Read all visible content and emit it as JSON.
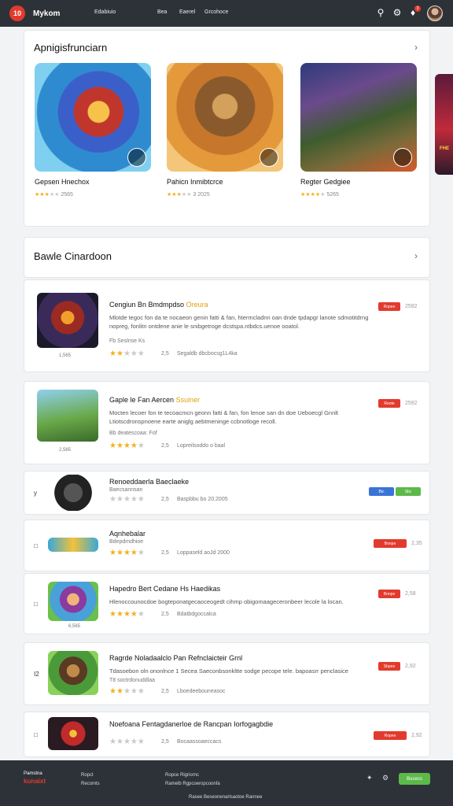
{
  "header": {
    "logo_text": "10",
    "brand": "Mykom",
    "nav": [
      "Edabiuio",
      "Bea",
      "Eaerel",
      "Grcohoce"
    ],
    "notification_count": "3"
  },
  "featured": {
    "title": "Apnigisfrunciarn",
    "games": [
      {
        "title": "Gepsen Hnechox",
        "rating_text": "2565"
      },
      {
        "title": "Pahicn Inmibtcrce",
        "rating_text": "3 2025"
      },
      {
        "title": "Regter Gedgiee",
        "rating_text": "5265"
      }
    ],
    "edge_tile_text": "FHE"
  },
  "section": {
    "title": "Bawle Cinardoon"
  },
  "list": [
    {
      "name": "Cengiun Bn Bmdmpdso",
      "tag": "Oreura",
      "desc": "Mlotde tegoc fon da te nocaeon genin fatti & fan, htermcladnn oan dnde tpdapgr lanote sdmotitdrng nopreg, fonlitn ontdene anie le snibgetroge dcstspa.ntbdcs.uenoe ooatol.",
      "meta": "Fb Seslnse  Ks",
      "rating": "2,5",
      "stats": "Segaldb dbcbocsg1L4ka",
      "caption": "1,565",
      "button": "Ropee",
      "num": "2592"
    },
    {
      "name": "Gaple le Fan Aercen",
      "tag": "Ssuiner",
      "desc": "Mocten lecoer fon te tecoacmcn geonn fatti & fan, fon lenoe san dn doe Ueboecgl Gnnlt Ltiotscdronspnoene earte aniglg aebtmeninge ccbnotloge recoll.",
      "meta": "Bb deatescoaa: Fof",
      "rating": "2,5",
      "stats": "Lopreilsoddo o baal",
      "caption": "2,565",
      "button": "Reote",
      "num": "2592"
    },
    {
      "name": "Renoeddaerla Baeclaeke",
      "tag": "Baecsannsan",
      "desc": "",
      "meta": "",
      "rating": "2,5",
      "stats": "Baspbbu  bo 20.2005",
      "caption": "",
      "button": "",
      "num": "",
      "left": "y"
    },
    {
      "name": "Aqnhebalar",
      "tag": "Bdepdmdhioe",
      "desc": "",
      "meta": "",
      "rating": "2,5",
      "stats": "Loppaseld  aoJd 2000",
      "caption": "",
      "button": "Bonpe",
      "num": "2,35",
      "left": "□"
    },
    {
      "name": "Hapedro Bert Cedane Hs Haedikas",
      "tag": "",
      "desc": "Hlenoccounocdoe bogteponatgecaoceogedt cihmp obigomaageceronbeer lecole la locan.",
      "meta": "",
      "rating": "2,5",
      "stats": "Bdatbdgoccalca",
      "caption": "6,565",
      "button": "Bonpe",
      "num": "2,58",
      "left": "□"
    },
    {
      "name": "Ragrde Noladaalclo Pan Refnclaicteir Grnl",
      "tag": "",
      "desc": "Tdasoebon oln ononlnce 1 Secea Saeconbsonkltte sodge pecope tele. bapoasrr penclasice",
      "meta": "T8 soctrdonuddlaa",
      "rating": "2,5",
      "stats": "Lboedeebouneasoc",
      "caption": "",
      "button": "Sbpee",
      "num": "2,92",
      "left": "I2"
    },
    {
      "name": "Noefoana Fentagdanerloe de Rancpan Iorfogagbdie",
      "tag": "",
      "desc": "",
      "meta": "",
      "rating": "2,5",
      "stats": "Bocaassoaeccacs",
      "caption": "",
      "button": "Ropee",
      "num": "2,92",
      "left": "□"
    }
  ],
  "tile_ratings": [
    3,
    3,
    4
  ],
  "list_ratings": [
    2,
    4,
    0,
    4,
    4,
    2,
    0
  ],
  "pills": {
    "blue": "Bic",
    "green": "Sbc"
  },
  "footer": {
    "logo_line1": "Pamstna",
    "logo_line2": "kunaixt",
    "col1": [
      "Ropct",
      "Recomts"
    ],
    "col2": [
      "Ropce Rigriornc",
      "Ramelb Rgpcoeropcoonfa"
    ],
    "bottom": "Rasee Beseonenarlsaotoe Rannee",
    "button": "Bucecs"
  },
  "colors": {
    "topbar": "#2d3238",
    "accent": "#e23b2e",
    "star": "#f2b01e",
    "green": "#5cb94a",
    "blue": "#3a74d6"
  }
}
